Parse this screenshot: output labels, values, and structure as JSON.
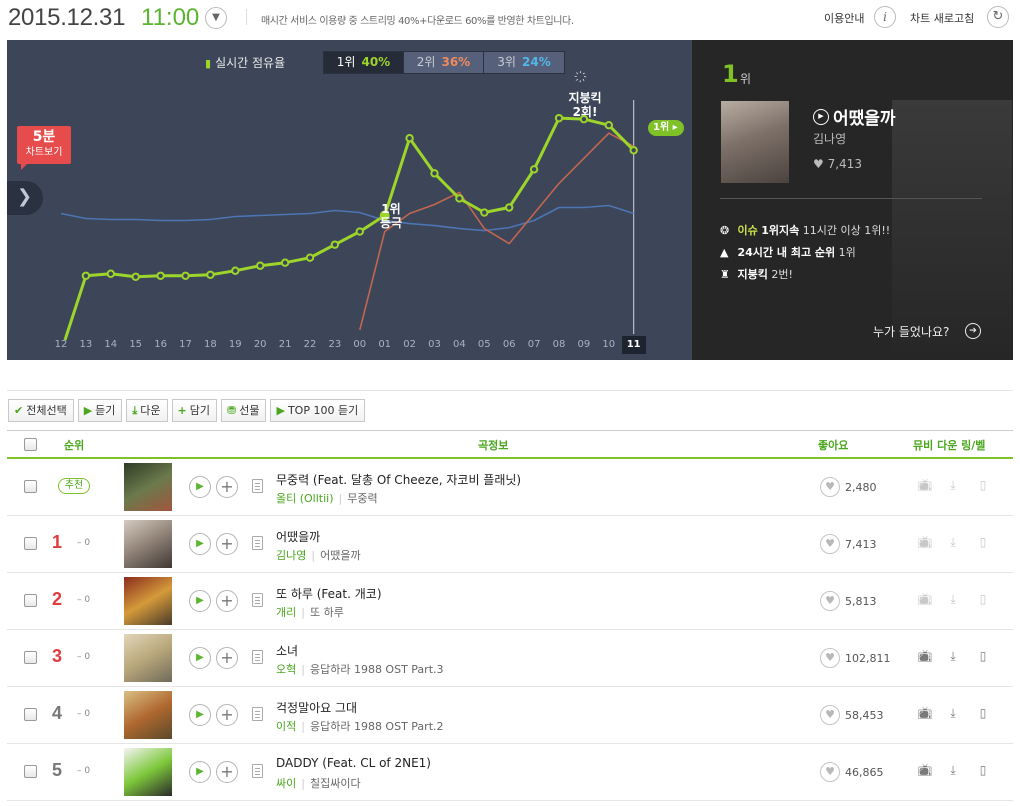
{
  "header": {
    "date": "2015.12.31",
    "time": "11:00",
    "note": "매시간 서비스 이용량 중 스트리밍 40%+다운로드 60%를 반영한 차트입니다.",
    "info_label": "이용안내",
    "refresh_label": "차트 새로고침"
  },
  "chart": {
    "share_label": "실시간 점유율",
    "tabs": [
      {
        "rank": "1위",
        "pct": "40%",
        "color": "#9ed52a"
      },
      {
        "rank": "2위",
        "pct": "36%",
        "color": "#f08a5d"
      },
      {
        "rank": "3위",
        "pct": "24%",
        "color": "#52b7e8"
      }
    ],
    "five_min_badge": {
      "line1": "5분",
      "line2": "차트보기"
    },
    "annotations": {
      "first_place": "1위\n등극",
      "realtime_peak": "지붕킥\n2회!"
    },
    "end_rank": "1위",
    "hours": [
      "12",
      "13",
      "14",
      "15",
      "16",
      "17",
      "18",
      "19",
      "20",
      "21",
      "22",
      "23",
      "00",
      "01",
      "02",
      "03",
      "04",
      "05",
      "06",
      "07",
      "08",
      "09",
      "10",
      "11"
    ],
    "current_hour": "11"
  },
  "chart_data": {
    "type": "line",
    "x": [
      "12",
      "13",
      "14",
      "15",
      "16",
      "17",
      "18",
      "19",
      "20",
      "21",
      "22",
      "23",
      "00",
      "01",
      "02",
      "03",
      "04",
      "05",
      "06",
      "07",
      "08",
      "09",
      "10",
      "11"
    ],
    "series": [
      {
        "name": "1위",
        "color": "#9ed52a",
        "values": [
          null,
          5.8,
          6.0,
          5.7,
          5.8,
          5.8,
          5.9,
          6.3,
          6.8,
          7.1,
          7.6,
          8.9,
          10.2,
          11.8,
          19.5,
          16.0,
          13.5,
          12.1,
          12.6,
          16.4,
          21.5,
          21.4,
          20.8,
          18.3
        ]
      },
      {
        "name": "2위",
        "color": "#c1664f",
        "values": [
          null,
          null,
          null,
          null,
          null,
          null,
          null,
          null,
          null,
          null,
          null,
          null,
          null,
          10.2,
          12.0,
          12.9,
          14.1,
          10.5,
          9.0,
          12.0,
          15.0,
          17.5,
          20.0,
          18.7
        ]
      },
      {
        "name": "3위",
        "color": "#4d74b3",
        "values": [
          12.0,
          11.5,
          11.4,
          11.4,
          11.3,
          11.3,
          11.4,
          11.7,
          11.8,
          11.9,
          12.0,
          12.3,
          12.1,
          11.3,
          11.0,
          10.8,
          10.5,
          10.3,
          10.6,
          11.3,
          12.6,
          12.6,
          12.8,
          12.0
        ]
      }
    ],
    "ylim": [
      0,
      25
    ]
  },
  "side": {
    "rank_num": "1",
    "rank_word": "위",
    "song_title": "어땠을까",
    "artist": "김나영",
    "likes": "7,413",
    "stats": [
      {
        "icon": "❂",
        "label": "이슈",
        "highlight": "1위지속",
        "desc": "11시간 이상 1위!!"
      },
      {
        "icon": "▲",
        "label": "",
        "highlight": "24시간 내 최고 순위",
        "desc": "1위"
      },
      {
        "icon": "♜",
        "label": "",
        "highlight": "지붕킥",
        "desc": "2번!"
      }
    ],
    "ask_label": "누가 들었나요?"
  },
  "toolbar": {
    "select_all": "전체선택",
    "listen": "듣기",
    "download": "다운",
    "add": "담기",
    "gift": "선물",
    "top100": "TOP 100 듣기"
  },
  "table": {
    "headers": {
      "rank": "순위",
      "song": "곡정보",
      "likes": "좋아요",
      "icons": "뮤비 다운 링/벨"
    },
    "rows": [
      {
        "rank": "추천",
        "change": "",
        "title": "무중력 (Feat. 달총 Of Cheeze, 자코비 플래닛)",
        "artist": "올티 (Olltii)",
        "album": "무중력",
        "likes": "2,480",
        "thumb": [
          "#2f3b24",
          "#6b7a4c",
          "#a2553e"
        ]
      },
      {
        "rank": "1",
        "change": "– 0",
        "title": "어땠을까",
        "artist": "김나영",
        "album": "어땠을까",
        "likes": "7,413",
        "thumb": [
          "#d6ccc1",
          "#8e8075",
          "#3f3834"
        ]
      },
      {
        "rank": "2",
        "change": "– 0",
        "title": "또 하루 (Feat. 개코)",
        "artist": "개리",
        "album": "또 하루",
        "likes": "5,813",
        "thumb": [
          "#8a2d1e",
          "#d49a3a",
          "#4a3a2a"
        ]
      },
      {
        "rank": "3",
        "change": "– 0",
        "title": "소녀",
        "artist": "오혁",
        "album": "응답하라 1988 OST Part.3",
        "likes": "102,811",
        "thumb": [
          "#e2d7b9",
          "#b8a67a",
          "#6f6a5a"
        ]
      },
      {
        "rank": "4",
        "change": "– 0",
        "title": "걱정말아요 그대",
        "artist": "이적",
        "album": "응답하라 1988 OST Part.2",
        "likes": "58,453",
        "thumb": [
          "#d9c085",
          "#b0682f",
          "#5a4a2a"
        ]
      },
      {
        "rank": "5",
        "change": "– 0",
        "title": "DADDY (Feat. CL of 2NE1)",
        "artist": "싸이",
        "album": "칠집싸이다",
        "likes": "46,865",
        "thumb": [
          "#f4f4f4",
          "#7ec83b",
          "#2a2a2a"
        ]
      }
    ]
  }
}
